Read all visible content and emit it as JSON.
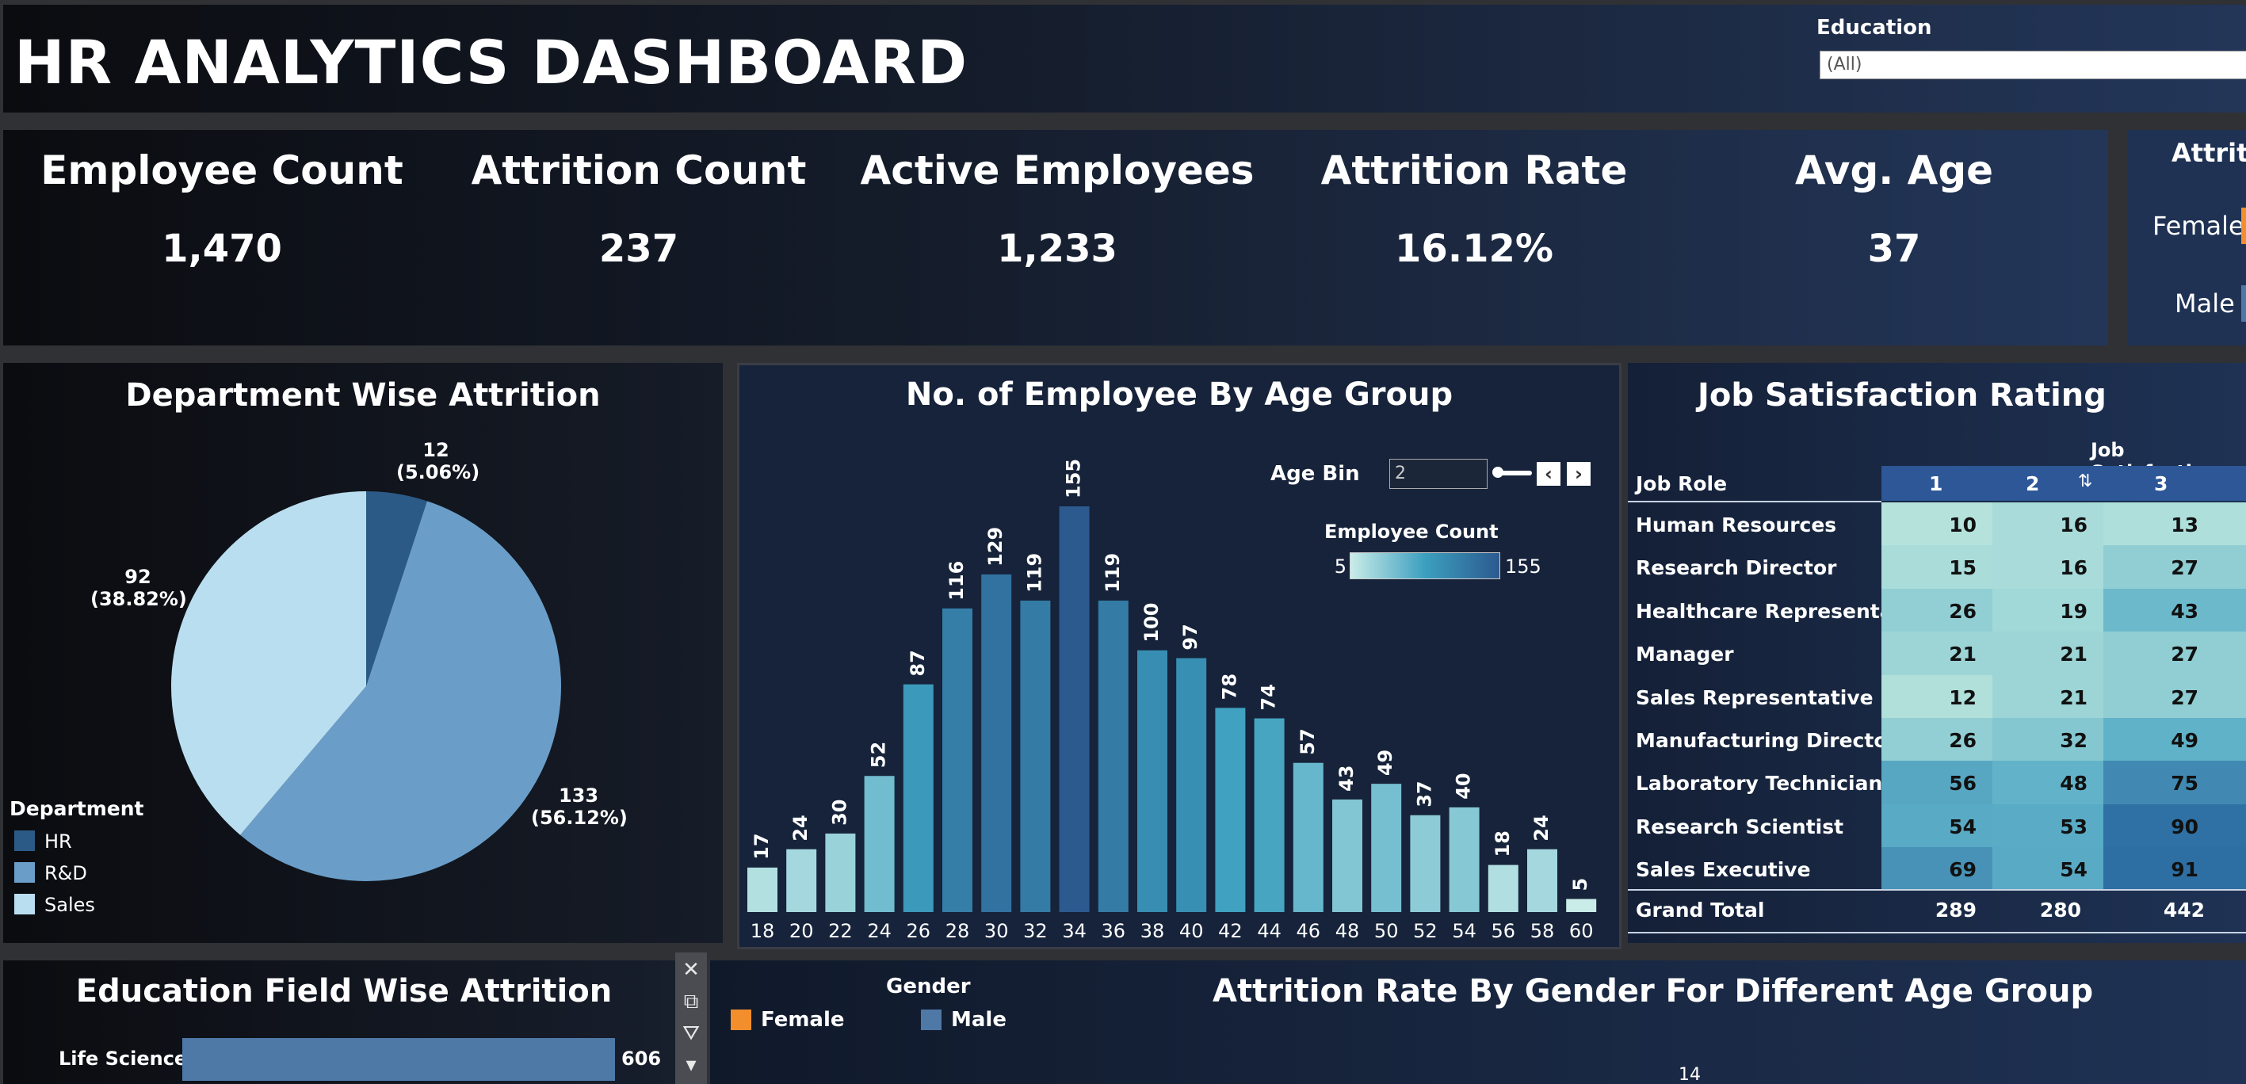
{
  "header": {
    "title": "HR ANALYTICS DASHBOARD",
    "filter_label": "Education",
    "filter_value": "(All)"
  },
  "kpis": [
    {
      "label": "Employee Count",
      "value": "1,470"
    },
    {
      "label": "Attrition Count",
      "value": "237"
    },
    {
      "label": "Active Employees",
      "value": "1,233"
    },
    {
      "label": "Attrition Rate",
      "value": "16.12%"
    },
    {
      "label": "Avg. Age",
      "value": "37"
    }
  ],
  "gender_panel": {
    "title": "Attriti",
    "female": "Female",
    "male": "Male",
    "colors": {
      "female": "#f28e2b",
      "male": "#4e79a7"
    }
  },
  "department": {
    "title": "Department Wise Attrition",
    "legend_title": "Department",
    "labels": [
      {
        "count": "12",
        "pct": "(5.06%)"
      },
      {
        "count": "133",
        "pct": "(56.12%)"
      },
      {
        "count": "92",
        "pct": "(38.82%)"
      }
    ]
  },
  "age_chart": {
    "title": "No. of  Employee By Age Group",
    "age_bin_label": "Age Bin",
    "age_bin_value": "2",
    "legend_title": "Employee Count",
    "legend_min": "5",
    "legend_max": "155"
  },
  "job_satisfaction": {
    "title": "Job Satisfaction Rating",
    "col_header": "Job Satisfaction",
    "role_header": "Job Role",
    "cols": [
      "1",
      "2",
      "3"
    ],
    "rows": [
      {
        "role": "Human Resources",
        "vals": [
          "10",
          "16",
          "13"
        ]
      },
      {
        "role": "Research Director",
        "vals": [
          "15",
          "16",
          "27"
        ]
      },
      {
        "role": "Healthcare Representative",
        "vals": [
          "26",
          "19",
          "43"
        ]
      },
      {
        "role": "Manager",
        "vals": [
          "21",
          "21",
          "27"
        ]
      },
      {
        "role": "Sales Representative",
        "vals": [
          "12",
          "21",
          "27"
        ]
      },
      {
        "role": "Manufacturing Director",
        "vals": [
          "26",
          "32",
          "49"
        ]
      },
      {
        "role": "Laboratory Technician",
        "vals": [
          "56",
          "48",
          "75"
        ]
      },
      {
        "role": "Research Scientist",
        "vals": [
          "54",
          "53",
          "90"
        ]
      },
      {
        "role": "Sales Executive",
        "vals": [
          "69",
          "54",
          "91"
        ]
      }
    ],
    "total_label": "Grand Total",
    "totals": [
      "289",
      "280",
      "442"
    ]
  },
  "education_field": {
    "title": "Education Field Wise Attrition",
    "first_label": "Life Sciences",
    "first_value": "606"
  },
  "gender_age": {
    "title": "Attrition Rate By Gender For Different Age Group",
    "legend_title": "Gender",
    "female": "Female",
    "male": "Male",
    "peek_value": "14"
  },
  "chart_data": [
    {
      "type": "pie",
      "title": "Department Wise Attrition",
      "legend_title": "Department",
      "categories": [
        "HR",
        "R&D",
        "Sales"
      ],
      "values": [
        12,
        133,
        92
      ],
      "percent": [
        5.06,
        56.12,
        38.82
      ],
      "colors": [
        "#2c5a87",
        "#6a9ec9",
        "#b9def0"
      ],
      "legend_position": "bottom-left"
    },
    {
      "type": "bar",
      "title": "No. of  Employee By Age Group",
      "categories": [
        "18",
        "20",
        "22",
        "24",
        "26",
        "28",
        "30",
        "32",
        "34",
        "36",
        "38",
        "40",
        "42",
        "44",
        "46",
        "48",
        "50",
        "52",
        "54",
        "56",
        "58",
        "60"
      ],
      "values": [
        17,
        24,
        30,
        52,
        87,
        116,
        129,
        119,
        155,
        119,
        100,
        97,
        78,
        74,
        57,
        43,
        49,
        37,
        40,
        18,
        24,
        5
      ],
      "color_scale": {
        "min": 5,
        "max": 155,
        "from": "#c9ece8",
        "to": "#2c5a8f"
      },
      "ylim": [
        0,
        155
      ],
      "grid": false
    },
    {
      "type": "heatmap",
      "title": "Job Satisfaction Rating",
      "x": [
        "1",
        "2",
        "3"
      ],
      "y": [
        "Human Resources",
        "Research Director",
        "Healthcare Representative",
        "Manager",
        "Sales Representative",
        "Manufacturing Director",
        "Laboratory Technician",
        "Research Scientist",
        "Sales Executive"
      ],
      "values": [
        [
          10,
          16,
          13
        ],
        [
          15,
          16,
          27
        ],
        [
          26,
          19,
          43
        ],
        [
          21,
          21,
          27
        ],
        [
          12,
          21,
          27
        ],
        [
          26,
          32,
          49
        ],
        [
          56,
          48,
          75
        ],
        [
          54,
          53,
          90
        ],
        [
          69,
          54,
          91
        ]
      ],
      "totals": [
        289,
        280,
        442
      ]
    },
    {
      "type": "bar",
      "title": "Education Field Wise Attrition",
      "categories": [
        "Life Sciences"
      ],
      "values": [
        606
      ]
    }
  ]
}
